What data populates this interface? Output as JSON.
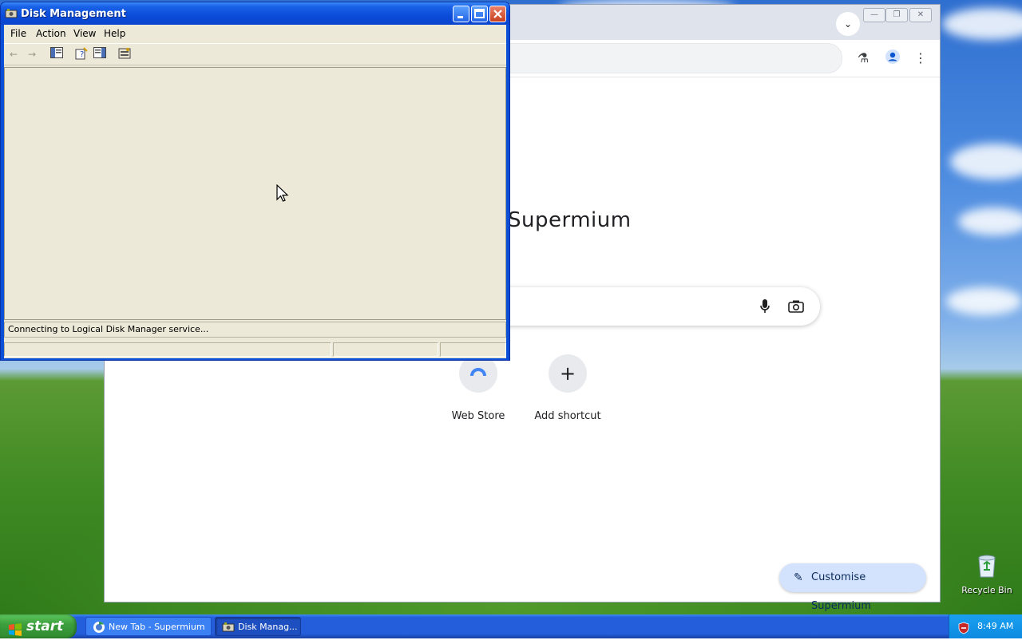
{
  "desktop": {
    "recycle_bin_label": "Recycle Bin"
  },
  "browser": {
    "ntp_title_fragment": "Supermium",
    "shortcuts": [
      {
        "label": "Web Store",
        "icon": "web-store-icon"
      },
      {
        "label": "Add shortcut",
        "icon": "plus-icon"
      }
    ],
    "customise_label": "Customise Supermium"
  },
  "disk_management": {
    "title": "Disk Management",
    "menu": [
      "File",
      "Action",
      "View",
      "Help"
    ],
    "status_message": "Connecting to Logical Disk Manager service..."
  },
  "taskbar": {
    "start_label": "start",
    "tasks": [
      {
        "label": "New Tab - Supermium",
        "active": false
      },
      {
        "label": "Disk Manag...",
        "active": true
      }
    ],
    "clock": "8:49 AM"
  },
  "colors": {
    "xp_title_blue": "#0a4bd8",
    "xp_window_face": "#ece9d8",
    "start_green": "#3c9f3c",
    "customise_bg": "#d3e3fd"
  }
}
